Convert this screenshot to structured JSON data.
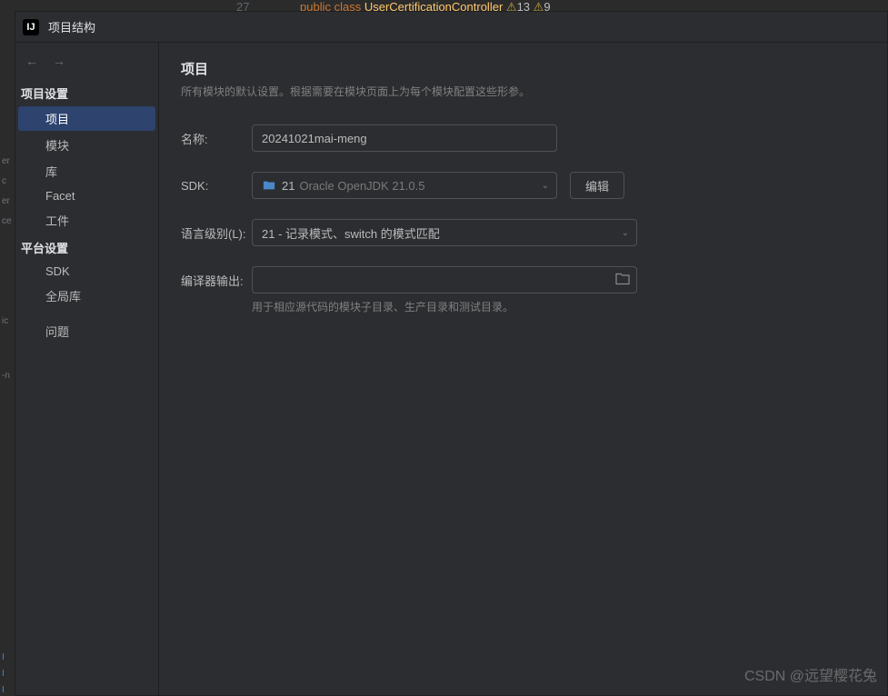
{
  "background_code": {
    "line_number": "27",
    "keyword": "public class",
    "class_name": "UserCertificationController",
    "warnings": "13",
    "warnings2": "9"
  },
  "dialog": {
    "app_icon_text": "IJ",
    "title": "项目结构"
  },
  "sidebar": {
    "section1_header": "项目设置",
    "section1_items": [
      "项目",
      "模块",
      "库",
      "Facet",
      "工件"
    ],
    "section2_header": "平台设置",
    "section2_items": [
      "SDK",
      "全局库"
    ],
    "section3_items": [
      "问题"
    ]
  },
  "content": {
    "title": "项目",
    "description": "所有模块的默认设置。根据需要在模块页面上为每个模块配置这些形参。",
    "name_label": "名称:",
    "name_value": "20241021mai-meng",
    "sdk_label": "SDK:",
    "sdk_version": "21",
    "sdk_vendor": "Oracle OpenJDK 21.0.5",
    "edit_button": "编辑",
    "lang_label": "语言级别(L):",
    "lang_value": "21 - 记录模式、switch 的模式匹配",
    "compiler_label": "编译器输出:",
    "compiler_value": "",
    "compiler_hint": "用于相应源代码的模块子目录、生产目录和测试目录。"
  },
  "gutter": {
    "items": [
      "er",
      "c",
      "er",
      "ce",
      "ic",
      "-n"
    ]
  },
  "watermark": "CSDN @远望樱花兔"
}
